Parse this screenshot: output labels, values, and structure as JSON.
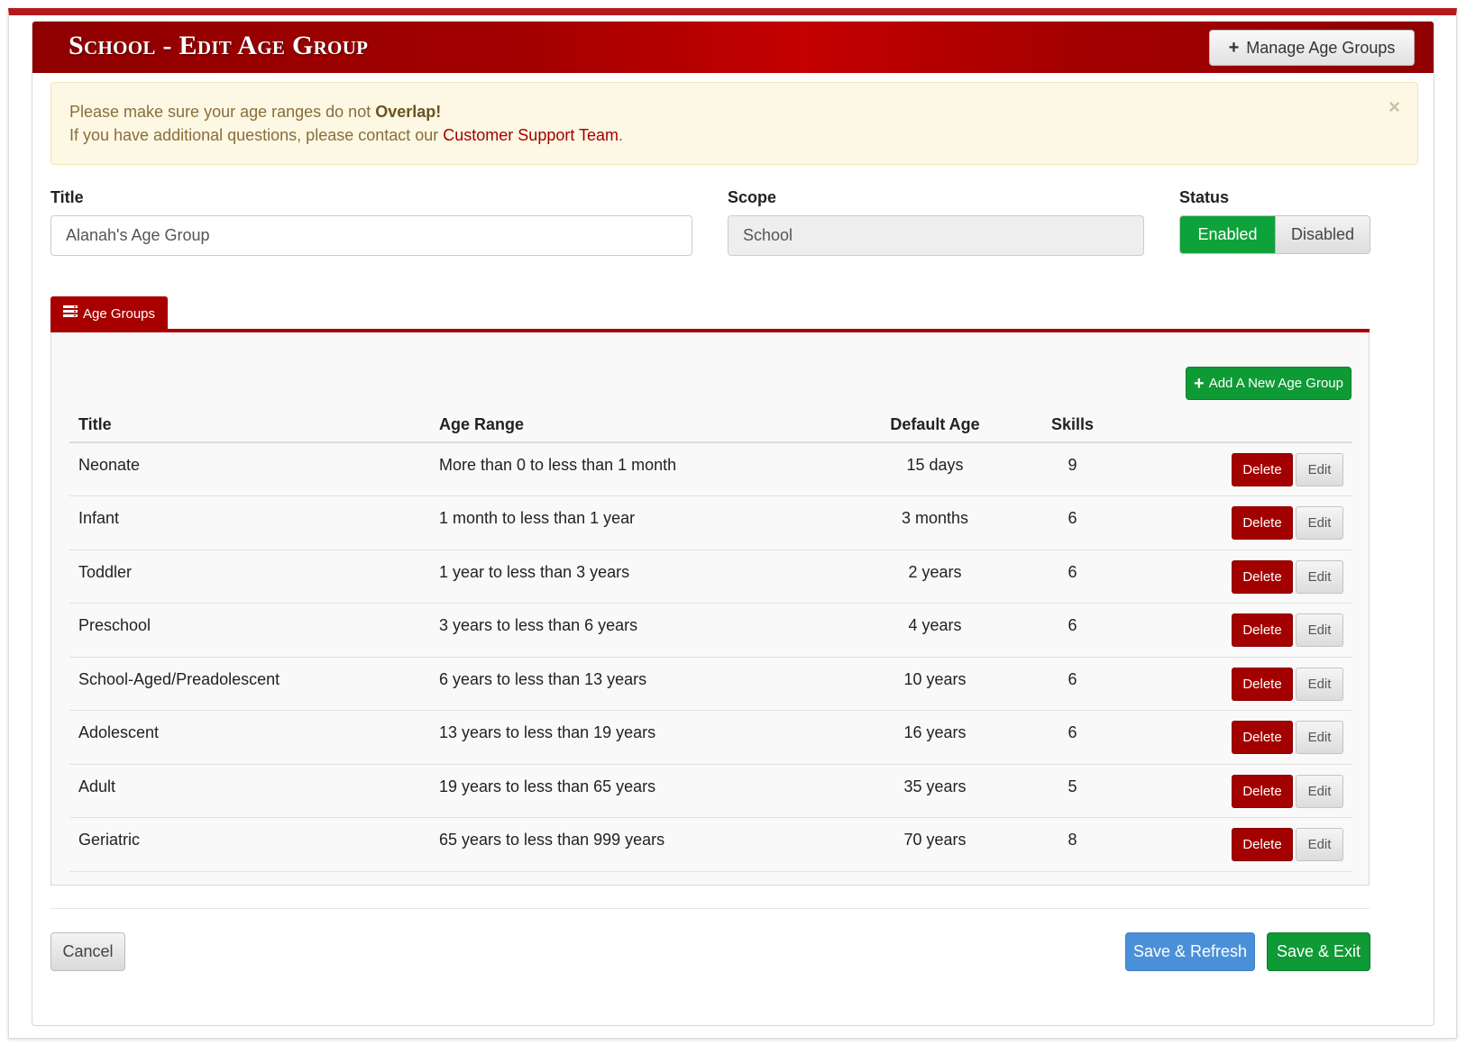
{
  "header": {
    "title": "School - Edit Age Group",
    "manage_button_label": "Manage Age Groups"
  },
  "alert": {
    "line1_prefix": "Please make sure your age ranges do not ",
    "line1_bold": "Overlap!",
    "line2_prefix": "If you have additional questions, please contact our ",
    "line2_link": "Customer Support Team",
    "line2_suffix": ".",
    "close_glyph": "×"
  },
  "form": {
    "title_label": "Title",
    "title_value": "Alanah's Age Group",
    "scope_label": "Scope",
    "scope_value": "School",
    "status_label": "Status",
    "status_enabled": "Enabled",
    "status_disabled": "Disabled",
    "status_selected": "Enabled"
  },
  "tabs": {
    "age_groups_label": "Age Groups",
    "age_groups_icon": "list-icon"
  },
  "table": {
    "add_button_label": "Add A New Age Group",
    "headers": {
      "title": "Title",
      "age_range": "Age Range",
      "default_age": "Default Age",
      "skills": "Skills"
    },
    "rows": [
      {
        "title": "Neonate",
        "age_range": "More than 0 to less than 1 month",
        "default_age": "15 days",
        "skills": "9"
      },
      {
        "title": "Infant",
        "age_range": "1 month to less than 1 year",
        "default_age": "3 months",
        "skills": "6"
      },
      {
        "title": "Toddler",
        "age_range": "1 year to less than 3 years",
        "default_age": "2 years",
        "skills": "6"
      },
      {
        "title": "Preschool",
        "age_range": "3 years to less than 6 years",
        "default_age": "4 years",
        "skills": "6"
      },
      {
        "title": "School-Aged/Preadolescent",
        "age_range": "6 years to less than 13 years",
        "default_age": "10 years",
        "skills": "6"
      },
      {
        "title": "Adolescent",
        "age_range": "13 years to less than 19 years",
        "default_age": "16 years",
        "skills": "6"
      },
      {
        "title": "Adult",
        "age_range": "19 years to less than 65 years",
        "default_age": "35 years",
        "skills": "5"
      },
      {
        "title": "Geriatric",
        "age_range": "65 years to less than 999 years",
        "default_age": "70 years",
        "skills": "8"
      }
    ],
    "delete_label": "Delete",
    "edit_label": "Edit"
  },
  "footer": {
    "cancel_label": "Cancel",
    "save_refresh_label": "Save & Refresh",
    "save_exit_label": "Save & Exit"
  },
  "colors": {
    "brand_red": "#a80000",
    "success_green": "#0e9a35",
    "info_blue": "#4a90d9",
    "alert_background": "#fcf8e3"
  }
}
